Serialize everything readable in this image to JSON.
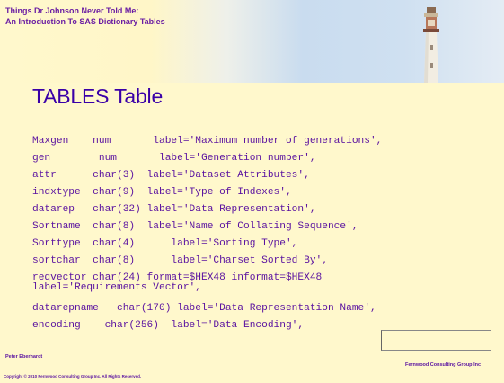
{
  "header": {
    "line1": "Things Dr Johnson Never Told Me:",
    "line2": "An Introduction To SAS Dictionary Tables"
  },
  "title": "TABLES Table",
  "code_lines": [
    "Maxgen    num       label='Maximum number of generations',",
    "gen        num       label='Generation number',",
    "attr      char(3)  label='Dataset Attributes',",
    "indxtype  char(9)  label='Type of Indexes',",
    "datarep   char(32) label='Data Representation',",
    "Sortname  char(8)  label='Name of Collating Sequence',",
    "Sorttype  char(4)      label='Sorting Type',",
    "sortchar  char(8)      label='Charset Sorted By',",
    "reqvector char(24) format=$HEX48 informat=$HEX48\nlabel='Requirements Vector',",
    "datarepname   char(170) label='Data Representation Name',",
    "encoding    char(256)  label='Data Encoding',"
  ],
  "footer": {
    "author": "Peter Eberhardt",
    "company": "Fernwood Consulting Group Inc",
    "copyright": "Copyright © 2010 Fernwood Consulting Group Inc. All Rights Reserved."
  },
  "colors": {
    "background": "#fff8cc",
    "text": "#5a12a0",
    "title": "#3a00a8",
    "header_text": "#6a1da3"
  },
  "icons": {
    "header_image": "lighthouse-image"
  }
}
